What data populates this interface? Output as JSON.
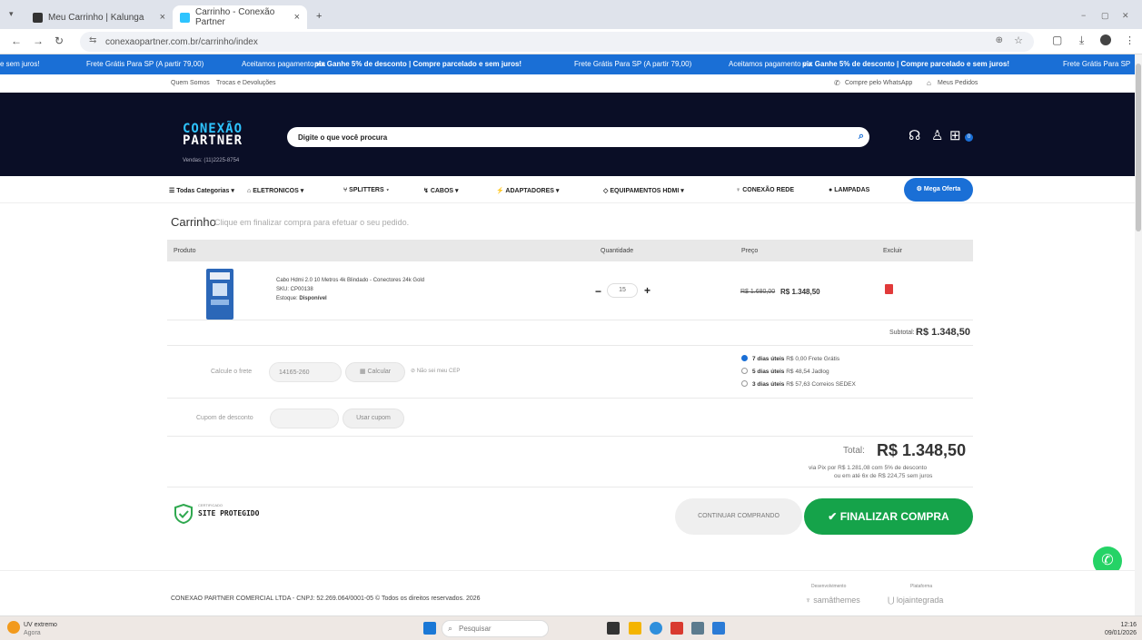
{
  "browser": {
    "tabs": [
      {
        "label": "Meu Carrinho | Kalunga",
        "close": "×"
      },
      {
        "label": "Carrinho - Conexão Partner",
        "close": "×"
      }
    ],
    "new_tab": "+",
    "url": "conexaopartner.com.br/carrinho/index",
    "window_controls": [
      "−",
      "▢",
      "✕"
    ]
  },
  "ticker": {
    "items": [
      "e sem juros!",
      "Frete Grátis Para SP (A partir 79,00)",
      "Aceitamos pagamento via",
      "pix Ganhe 5% de desconto | Compre parcelado e sem juros!",
      "Frete Grátis Para SP (A partir 79,00)",
      "Aceitamos pagamento via",
      "pix Ganhe 5% de desconto | Compre parcelado e sem juros!",
      "Frete Grátis Para SP"
    ]
  },
  "topbar": {
    "about": "Quem Somos",
    "exchanges": "Trocas e Devoluções",
    "whatsapp": "Compre pelo WhatsApp",
    "orders": "Meus Pedidos"
  },
  "header": {
    "logo_line1": "CONEXÃO",
    "logo_line2": "PARTNER",
    "sales_phone": "Vendas: (11)2225-8754",
    "search_placeholder": "Digite o que você procura",
    "cart_count": "0"
  },
  "categories": [
    "Todas Categorias",
    "ELETRONICOS",
    "SPLITTERS",
    "CABOS",
    "ADAPTADORES",
    "EQUIPAMENTOS HDMI",
    "CONEXÃO REDE",
    "LAMPADAS"
  ],
  "mega_offer": "Mega Oferta",
  "cart": {
    "title": "Carrinho",
    "subtitle": "Clique em finalizar compra para efetuar o seu pedido.",
    "columns": [
      "Produto",
      "Quantidade",
      "Preço",
      "Excluir"
    ],
    "item": {
      "name": "Cabo Hdmi 2.0 10 Metros 4k Blindado - Conectores 24k Gold",
      "sku": "SKU: CP00138",
      "stock_label": "Estoque:",
      "stock_value": "Disponível",
      "quantity": "15",
      "old_price": "R$ 1.680,00",
      "price": "R$ 1.348,50"
    },
    "subtotal_label": "Subtotal:",
    "subtotal_value": "R$ 1.348,50",
    "shipping": {
      "label": "Calcule o frete",
      "cep_value": "14165-260",
      "calc_button": "Calcular",
      "no_cep": "Não sei meu CEP",
      "options": [
        {
          "days": "7 dias úteis",
          "detail": "R$ 0,00 Frete Grátis",
          "selected": true
        },
        {
          "days": "5 dias úteis",
          "detail": "R$ 48,54 Jadlog",
          "selected": false
        },
        {
          "days": "3 dias úteis",
          "detail": "R$ 57,63 Correios SEDEX",
          "selected": false
        }
      ]
    },
    "coupon": {
      "label": "Cupom de desconto",
      "placeholder": "",
      "button": "Usar cupom"
    },
    "total_label": "Total:",
    "total_value": "R$ 1.348,50",
    "pix_line": "via Pix por R$ 1.281,08 com 5% de desconto",
    "installment_line": "ou em até 6x de R$ 224,75 sem juros"
  },
  "seal": {
    "small": "CERTIFICADO",
    "title": "SITE PROTEGIDO"
  },
  "buttons": {
    "continue": "CONTINUAR COMPRANDO",
    "finalize": "FINALIZAR COMPRA"
  },
  "footer": {
    "copyright": "CONEXAO PARTNER COMERCIAL LTDA - CNPJ: 52.269.064/0001-05 © Todos os direitos reservados. 2026",
    "dev_label": "Desenvolvimento",
    "dev_brand": "samâthemes",
    "platform_label": "Plataforma",
    "platform_brand": "lojaintegrada"
  },
  "taskbar": {
    "weather_title": "UV extremo",
    "weather_sub": "Agora",
    "search": "Pesquisar",
    "time": "12:16",
    "date": "09/01/2026"
  },
  "colors": {
    "primary_blue": "#1a6fd6",
    "header_dark": "#0a0e26",
    "finalize_green": "#15a34a",
    "delete_red": "#e13a3a"
  }
}
